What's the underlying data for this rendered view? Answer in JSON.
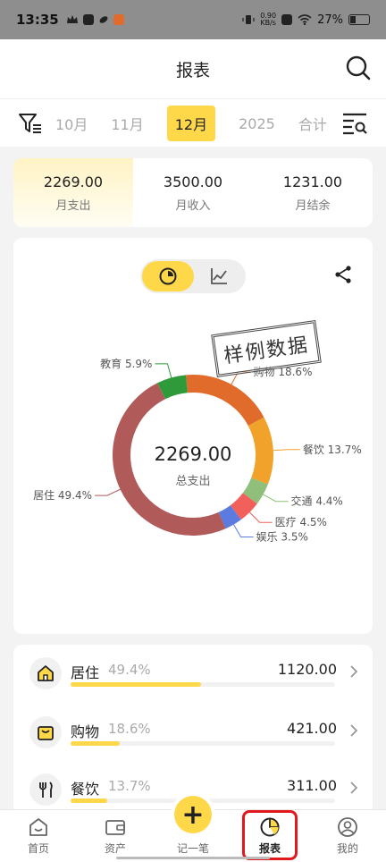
{
  "status": {
    "time": "13:35",
    "net_speed_value": "0.90",
    "net_speed_unit": "KB/s",
    "battery": "27%"
  },
  "header": {
    "title": "报表"
  },
  "months": [
    "10月",
    "11月",
    "12月",
    "2025",
    "合计"
  ],
  "active_month_index": 2,
  "summary": [
    {
      "value": "2269.00",
      "label": "月支出"
    },
    {
      "value": "3500.00",
      "label": "月收入"
    },
    {
      "value": "1231.00",
      "label": "月结余"
    }
  ],
  "chart": {
    "stamp": "样例数据",
    "center_value": "2269.00",
    "center_label": "总支出"
  },
  "chart_data": {
    "type": "pie",
    "categories": [
      "居住",
      "购物",
      "餐饮",
      "交通",
      "医疗",
      "娱乐",
      "教育"
    ],
    "values": [
      49.4,
      18.6,
      13.7,
      4.4,
      4.5,
      3.5,
      5.9
    ],
    "labels": [
      "居住 49.4%",
      "购物 18.6%",
      "餐饮 13.7%",
      "交通 4.4%",
      "医疗 4.5%",
      "娱乐 3.5%",
      "教育 5.9%"
    ],
    "colors": [
      "#b05a5a",
      "#e06b2b",
      "#f0a22a",
      "#8fbf7a",
      "#f2605c",
      "#5b7be0",
      "#2e9a3a"
    ],
    "total": "2269.00"
  },
  "categories_list": [
    {
      "name": "居住",
      "pct": "49.4%",
      "amount": "1120.00",
      "fraction": 0.494,
      "icon": "home-icon"
    },
    {
      "name": "购物",
      "pct": "18.6%",
      "amount": "421.00",
      "fraction": 0.186,
      "icon": "shopping-bag-icon"
    },
    {
      "name": "餐饮",
      "pct": "13.7%",
      "amount": "311.00",
      "fraction": 0.137,
      "icon": "fork-knife-icon"
    }
  ],
  "nav": {
    "home": "首页",
    "assets": "资产",
    "record": "记一笔",
    "reports": "报表",
    "mine": "我的"
  },
  "colors": {
    "accent": "#ffd84a",
    "highlight": "#e0191e"
  }
}
